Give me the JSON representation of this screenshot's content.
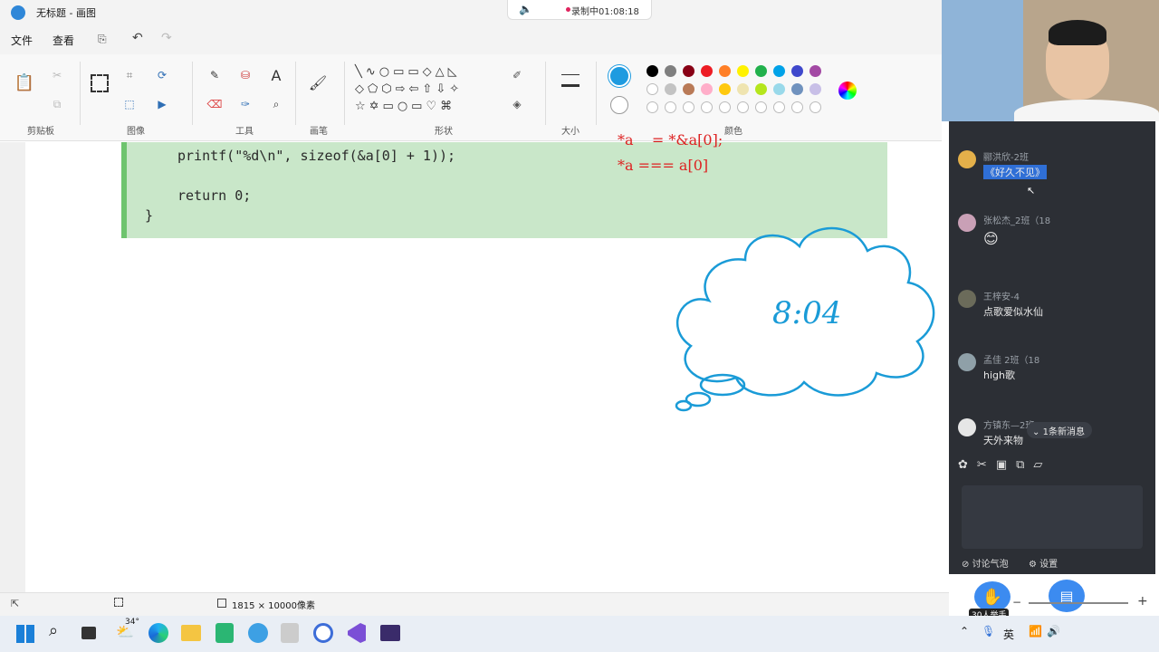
{
  "window": {
    "title": "无标题 - 画图"
  },
  "recording": {
    "text": "录制中01:08:18"
  },
  "menu": {
    "file": "文件",
    "view": "查看"
  },
  "ribbon": {
    "groups": {
      "clipboard": "剪贴板",
      "image": "图像",
      "tools": "工具",
      "brushes": "画笔",
      "shapes": "形状",
      "size": "大小",
      "colors": "颜色"
    }
  },
  "colors": {
    "row1": [
      "#000000",
      "#7f7f7f",
      "#880015",
      "#ed1c24",
      "#ff7f27",
      "#fff200",
      "#22b14c",
      "#00a2e8",
      "#3f48cc",
      "#a349a4"
    ],
    "row2": [
      "#ffffff",
      "#c3c3c3",
      "#b97a57",
      "#ffaec9",
      "#ffc90e",
      "#efe4b0",
      "#b5e61d",
      "#99d9ea",
      "#7092be",
      "#c8bfe7"
    ],
    "color1": "#1e9be0",
    "color2": "#ffffff"
  },
  "code": {
    "line1": "printf(\"%d\\n\", sizeof(&a[0] + 1));",
    "line2": "return 0;",
    "line3": "}"
  },
  "annotation": {
    "line1": "*a    = *&a[0];",
    "line2": "*a === a[0]"
  },
  "cloud": {
    "text": "8:04"
  },
  "status": {
    "canvas_size": "1815 × 10000像素"
  },
  "chat": {
    "messages": [
      {
        "name": "郦洪欣-2班",
        "text": "《好久不见》"
      },
      {
        "name": "张松杰_2班（18",
        "text": "😊"
      },
      {
        "name": "王梓安-4",
        "text": "点歌爱似水仙"
      },
      {
        "name": "孟佳 2班（18",
        "text": "high歌"
      },
      {
        "name": "方镇东—2班",
        "text": "天外来物"
      }
    ],
    "new_messages": "1条新消息",
    "discussion": "讨论气泡",
    "settings": "设置",
    "raise_hand": "30人举手"
  },
  "taskbar": {
    "weather": "34°",
    "ime": "英"
  }
}
